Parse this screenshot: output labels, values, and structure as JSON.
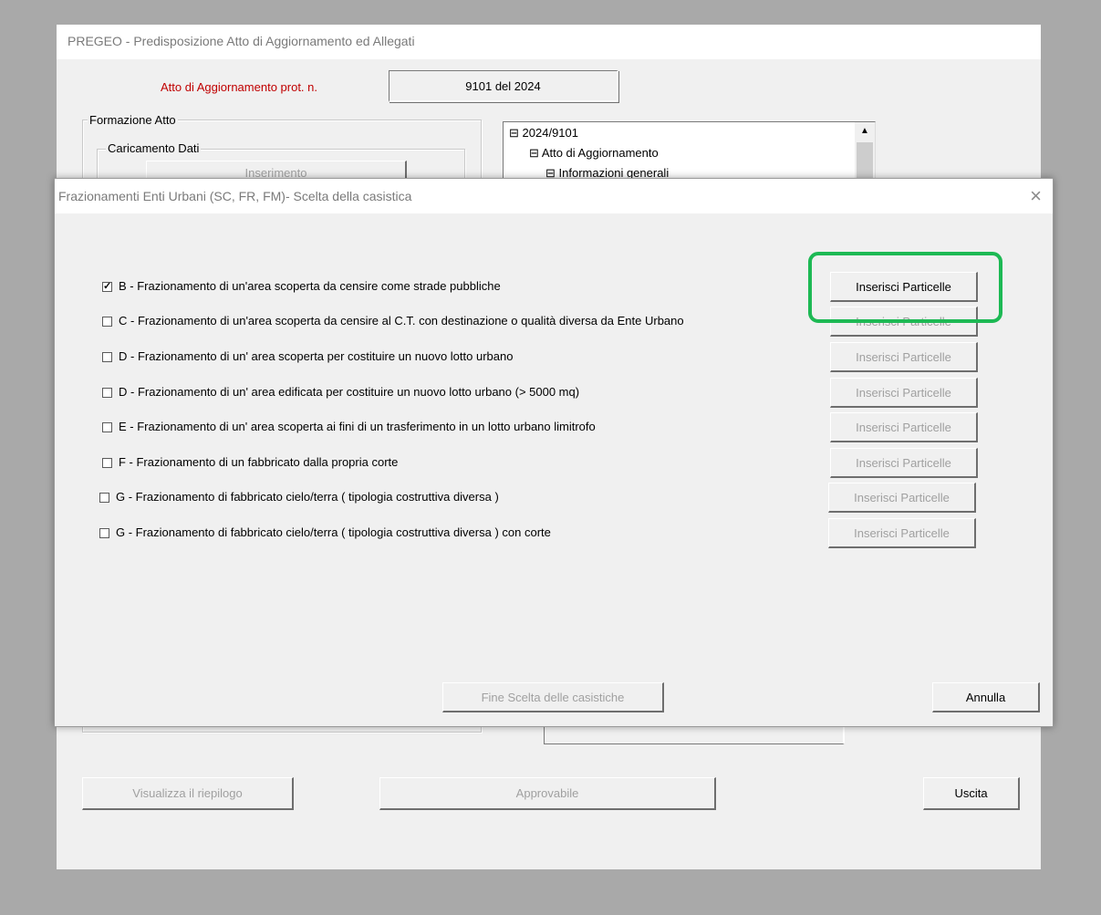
{
  "main_window": {
    "title": "PREGEO - Predisposizione Atto di Aggiornamento ed Allegati",
    "atto_label": "Atto di Aggiornamento prot. n.",
    "atto_value": "9101 del 2024",
    "formazione_legend": "Formazione Atto",
    "caricamento_legend": "Caricamento Dati",
    "inserimento_label": "Inserimento",
    "tree": {
      "root": "2024/9101",
      "child": "Atto di Aggiornamento",
      "grandchild": "Informazioni generali"
    },
    "buttons": {
      "riepilogo": "Visualizza il riepilogo",
      "approvabile": "Approvabile",
      "uscita": "Uscita"
    }
  },
  "dialog": {
    "title": "Frazionamenti Enti Urbani (SC, FR, FM)- Scelta della casistica",
    "close_icon": "close-icon",
    "rows": [
      {
        "checked": true,
        "label": "B - Frazionamento di un'area scoperta da censire come strade pubbliche",
        "button": "Inserisci Particelle",
        "enabled": true
      },
      {
        "checked": false,
        "label": "C - Frazionamento di un'area scoperta da censire al C.T. con destinazione o qualità diversa da Ente Urbano",
        "button": "Inserisci Particelle",
        "enabled": false
      },
      {
        "checked": false,
        "label": "D - Frazionamento di un' area scoperta per costituire un nuovo lotto urbano",
        "button": "Inserisci Particelle",
        "enabled": false
      },
      {
        "checked": false,
        "label": "D - Frazionamento di un' area edificata per costituire un nuovo lotto urbano  (> 5000 mq)",
        "button": "Inserisci Particelle",
        "enabled": false
      },
      {
        "checked": false,
        "label": "E - Frazionamento di un' area scoperta ai fini di un trasferimento in un lotto urbano limitrofo",
        "button": "Inserisci Particelle",
        "enabled": false
      },
      {
        "checked": false,
        "label": "F - Frazionamento di un fabbricato dalla propria corte",
        "button": "Inserisci Particelle",
        "enabled": false
      },
      {
        "checked": false,
        "label": "G - Frazionamento di fabbricato cielo/terra ( tipologia costruttiva diversa )",
        "button": "Inserisci Particelle",
        "enabled": false
      },
      {
        "checked": false,
        "label": "G - Frazionamento di fabbricato cielo/terra ( tipologia costruttiva diversa ) con corte",
        "button": "Inserisci Particelle",
        "enabled": false
      }
    ],
    "fine_button": "Fine Scelta delle casistiche",
    "annulla_button": "Annulla",
    "highlight_color": "#1db954"
  }
}
